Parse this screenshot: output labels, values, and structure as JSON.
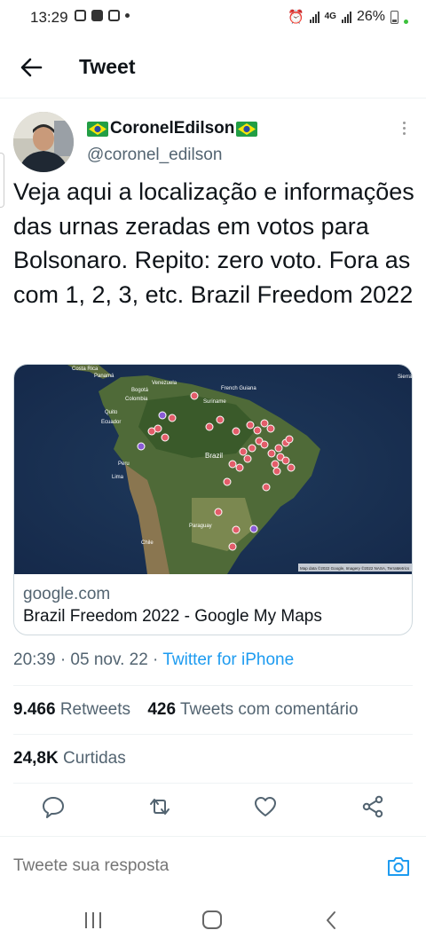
{
  "status_bar": {
    "time": "13:29",
    "network_type": "4G",
    "battery_percent": "26%"
  },
  "header": {
    "title": "Tweet"
  },
  "tweet": {
    "display_name": "CoronelEdilson",
    "handle": "@coronel_edilson",
    "text": "Veja aqui a localização e informações das urnas zeradas em votos para Bolsonaro. Repito: zero voto. Fora as com 1, 2, 3, etc.  Brazil Freedom 2022",
    "card": {
      "domain": "google.com",
      "title": "Brazil Freedom 2022 - Google My Maps",
      "map_labels": {
        "costa_rica": "Costa Rica",
        "panama": "Panamá",
        "venezuela": "Venezuela",
        "bogota": "Bogotá",
        "colombia": "Colombia",
        "quito": "Quito",
        "ecuador": "Ecuador",
        "peru": "Peru",
        "lima": "Lima",
        "french_guiana": "French Guiana",
        "suriname": "Suriname",
        "brazil": "Brazil",
        "paraguay": "Paraguay",
        "chile": "Chile",
        "sierra": "Sierra",
        "attribution": "Map data ©2022 Google, Imagery ©2022 NASA, TerraMetrics"
      }
    },
    "timestamp": "20:39 · 05 nov. 22 · ",
    "source": "Twitter for iPhone",
    "stats": {
      "retweets_count": "9.466",
      "retweets_label": "Retweets",
      "quotes_count": "426",
      "quotes_label": "Tweets com comentário",
      "likes_count": "24,8K",
      "likes_label": "Curtidas"
    }
  },
  "reply": {
    "placeholder": "Tweete sua resposta"
  },
  "icons": {
    "back": "arrow-left-icon",
    "more": "more-vertical-icon",
    "reply": "comment-icon",
    "retweet": "retweet-icon",
    "like": "heart-icon",
    "share": "share-icon",
    "camera": "camera-icon",
    "nav_recent": "recent-apps-icon",
    "nav_home": "home-icon",
    "nav_back": "nav-back-icon"
  },
  "colors": {
    "accent": "#1d9bf0",
    "secondary_text": "#536471",
    "primary_text": "#0f1419",
    "marker": "#e35d6a"
  }
}
